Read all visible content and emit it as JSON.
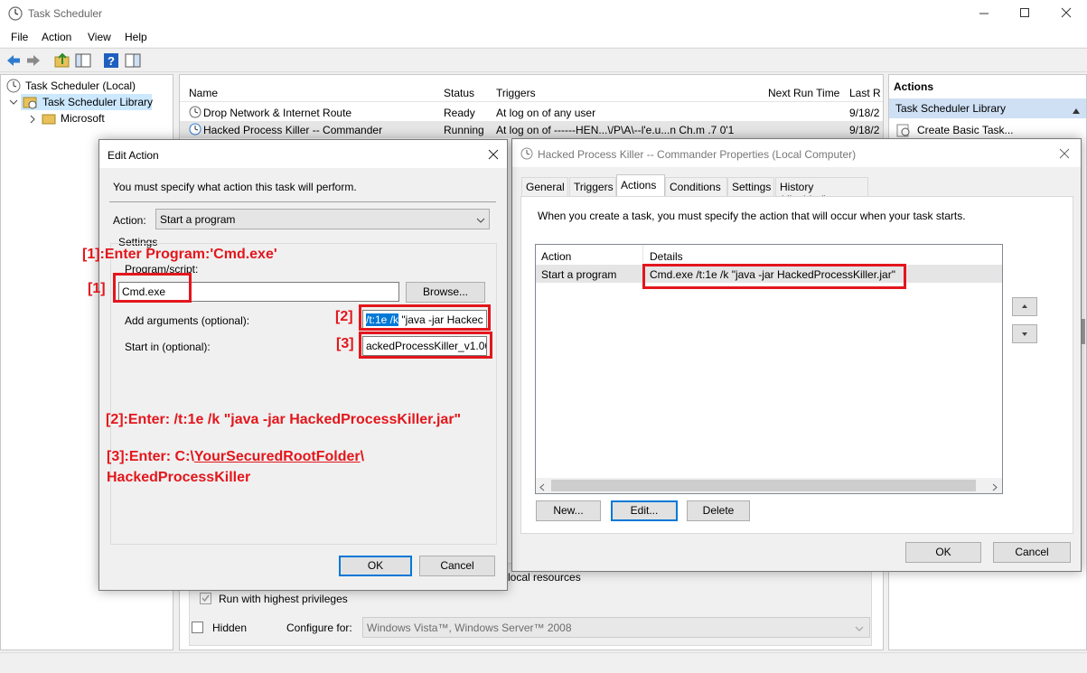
{
  "window": {
    "title": "Task Scheduler",
    "menu": [
      "File",
      "Action",
      "View",
      "Help"
    ]
  },
  "tree": {
    "root": "Task Scheduler (Local)",
    "library": "Task Scheduler Library",
    "child": "Microsoft"
  },
  "task_list": {
    "columns": [
      "Name",
      "Status",
      "Triggers",
      "Next Run Time",
      "Last R"
    ],
    "rows": [
      {
        "name": "Drop Network & Internet Route",
        "status": "Ready",
        "trigger": "At log on of any user",
        "next": "",
        "last": "9/18/2"
      },
      {
        "name": "Hacked Process Killer -- Commander",
        "status": "Running",
        "trigger": "At log on of ------HEN...\\/P\\A\\--l'e.u...n Ch.m .7 0'1",
        "next": "",
        "last": "9/18/2"
      }
    ]
  },
  "general_bottom": {
    "local_resources": "local resources",
    "run_highest": "Run with highest privileges",
    "hidden": "Hidden",
    "configure_for": "Configure for:",
    "configure_value": "Windows Vista™, Windows Server™ 2008"
  },
  "actions_pane": {
    "header": "Actions",
    "section": "Task Scheduler Library",
    "item1": "Create Basic Task..."
  },
  "properties": {
    "title": "Hacked Process Killer -- Commander Properties (Local Computer)",
    "tabs": [
      "General",
      "Triggers",
      "Actions",
      "Conditions",
      "Settings",
      "History (disabled)"
    ],
    "intro": "When you create a task, you must specify the action that will occur when your task starts.",
    "col_action": "Action",
    "col_details": "Details",
    "row_action": "Start a program",
    "row_details": "Cmd.exe /t:1e /k \"java -jar HackedProcessKiller.jar\"",
    "btn_new": "New...",
    "btn_edit": "Edit...",
    "btn_delete": "Delete",
    "btn_ok": "OK",
    "btn_cancel": "Cancel"
  },
  "edit_action": {
    "title": "Edit Action",
    "intro": "You must specify what action this task will perform.",
    "action_label": "Action:",
    "action_value": "Start a program",
    "settings_label": "Settings",
    "program_label": "Program/script:",
    "program_value": "Cmd.exe",
    "browse": "Browse...",
    "args_label": "Add arguments (optional):",
    "args_selected": "/t:1e /k",
    "args_rest": " \"java -jar Hackec",
    "startin_label": "Start in (optional):",
    "startin_value": "ackedProcessKiller_v1.06",
    "ok": "OK",
    "cancel": "Cancel"
  },
  "annotations": {
    "a1_top": "[1]:Enter Program:'Cmd.exe'",
    "a1_marker": "[1]",
    "a2_marker": "[2]",
    "a3_marker": "[3]",
    "a2_text": "[2]:Enter: /t:1e /k \"java -jar HackedProcessKiller.jar\"",
    "a3_prefix": "[3]:Enter: C:\\",
    "a3_underlined": "YourSecuredRootFolder",
    "a3_suffix": "\\",
    "a3_line2": "HackedProcessKiller"
  },
  "colors": {
    "annotation_red": "#e3161c",
    "selection_blue": "#0078d7",
    "selected_row": "#cce8ff"
  }
}
